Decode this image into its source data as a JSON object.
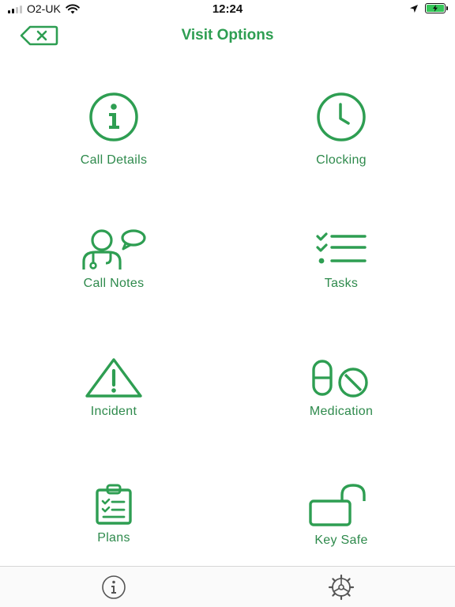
{
  "status_bar": {
    "carrier": "O2-UK",
    "time": "12:24",
    "signal_bars_active": 2,
    "battery_level": 1.0,
    "battery_charging": true
  },
  "nav": {
    "title": "Visit Options",
    "back_icon": "delete-back-icon"
  },
  "options": [
    {
      "label": "Call Details",
      "icon": "info-circle-icon"
    },
    {
      "label": "Clocking",
      "icon": "clock-icon"
    },
    {
      "label": "Call Notes",
      "icon": "people-speech-icon"
    },
    {
      "label": "Tasks",
      "icon": "checklist-icon"
    },
    {
      "label": "Incident",
      "icon": "warning-triangle-icon"
    },
    {
      "label": "Medication",
      "icon": "pill-icon"
    },
    {
      "label": "Plans",
      "icon": "clipboard-icon"
    },
    {
      "label": "Key Safe",
      "icon": "unlocked-padlock-icon"
    }
  ],
  "tab_bar": {
    "tabs": [
      {
        "icon": "info-icon"
      },
      {
        "icon": "settings-wheel-icon"
      }
    ]
  },
  "colors": {
    "accent": "#2e9e52",
    "label": "#2e8a4c",
    "tab_icon": "#555555"
  }
}
